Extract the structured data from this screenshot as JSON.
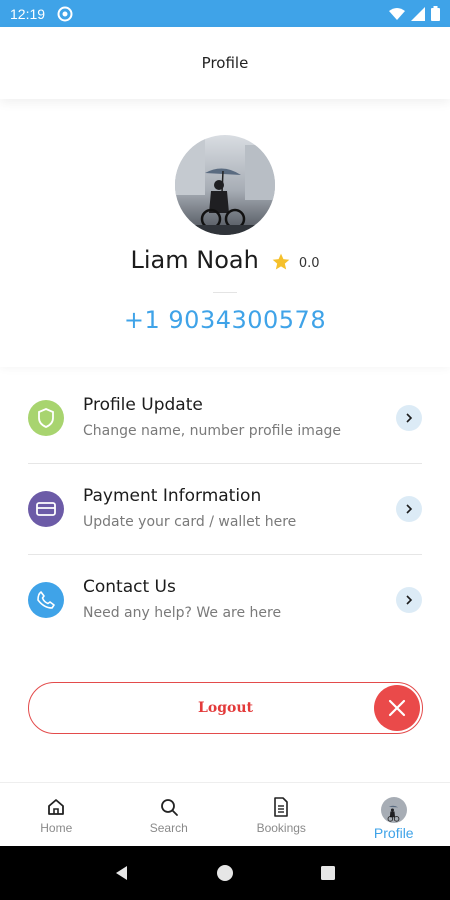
{
  "status_bar": {
    "time": "12:19"
  },
  "header": {
    "title": "Profile"
  },
  "profile": {
    "name": "Liam Noah",
    "rating": "0.0",
    "phone": "+1 9034300578"
  },
  "menu": {
    "items": [
      {
        "title": "Profile Update",
        "subtitle": "Change name, number profile image",
        "icon": "shield-icon",
        "color": "#a8d46f"
      },
      {
        "title": "Payment Information",
        "subtitle": "Update your card / wallet here",
        "icon": "card-icon",
        "color": "#6c5ba7"
      },
      {
        "title": "Contact Us",
        "subtitle": "Need any help? We are here",
        "icon": "phone-icon",
        "color": "#3fa3e8"
      }
    ]
  },
  "logout": {
    "label": "Logout",
    "color": "#e34b4b"
  },
  "bottom_nav": {
    "items": [
      {
        "label": "Home",
        "icon": "home-icon"
      },
      {
        "label": "Search",
        "icon": "search-icon"
      },
      {
        "label": "Bookings",
        "icon": "document-icon"
      },
      {
        "label": "Profile",
        "icon": "avatar"
      }
    ],
    "active": "Profile"
  },
  "colors": {
    "accent": "#3fa3e8",
    "danger": "#e34b4b"
  }
}
